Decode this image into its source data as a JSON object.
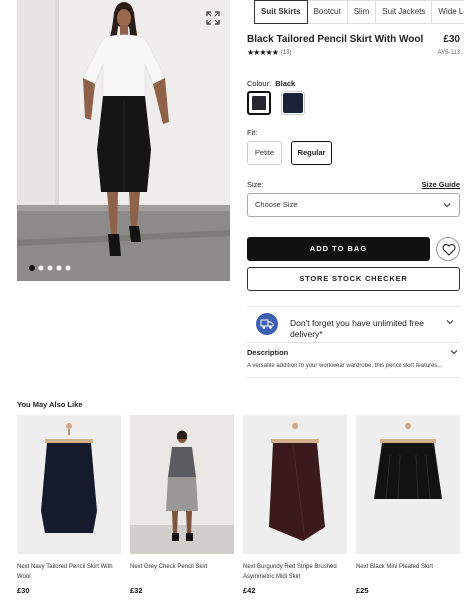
{
  "gallery": {
    "slide_count": 5,
    "active_slide": 1,
    "expand_icon": "expand-icon"
  },
  "tabs": [
    "Suit Skirts",
    "Bootcut",
    "Slim",
    "Suit Jackets",
    "Wide Leg"
  ],
  "active_tab": "Suit Skirts",
  "product": {
    "title": "Black Tailored Pencil Skirt With Wool",
    "price": "£30",
    "stars": "★★★★★",
    "reviews": "(13)",
    "code": "AY5-113"
  },
  "colour": {
    "label": "Colour:",
    "selected": "Black",
    "swatches": [
      "#262830",
      "#1c2238"
    ]
  },
  "fit": {
    "label": "Fit:",
    "options": [
      "Petite",
      "Regular"
    ],
    "selected": "Regular"
  },
  "size": {
    "label": "Size:",
    "guide": "Size Guide",
    "placeholder": "Choose Size"
  },
  "buttons": {
    "add_to_bag": "ADD TO BAG",
    "store_stock": "STORE STOCK CHECKER",
    "wishlist_icon": "heart-icon"
  },
  "delivery": {
    "text": "Don't forget you have unlimited free delivery*",
    "accent": "#3c5fb1"
  },
  "description": {
    "title": "Description",
    "text": "A versatile addition to your workwear wardrobe, this pencil skirt features..."
  },
  "ymal": {
    "title": "You May Also Like",
    "items": [
      {
        "name": "Next Navy Tailored Pencil Skirt With Wool",
        "price": "£30"
      },
      {
        "name": "Next Grey Check Pencil Skirt",
        "price": "£32"
      },
      {
        "name": "Next Burgundy Red Stripe Brushed Asymmetric Midi Skirt",
        "price": "£42"
      },
      {
        "name": "Next Black Mini Pleated Skirt",
        "price": "£25"
      }
    ]
  }
}
